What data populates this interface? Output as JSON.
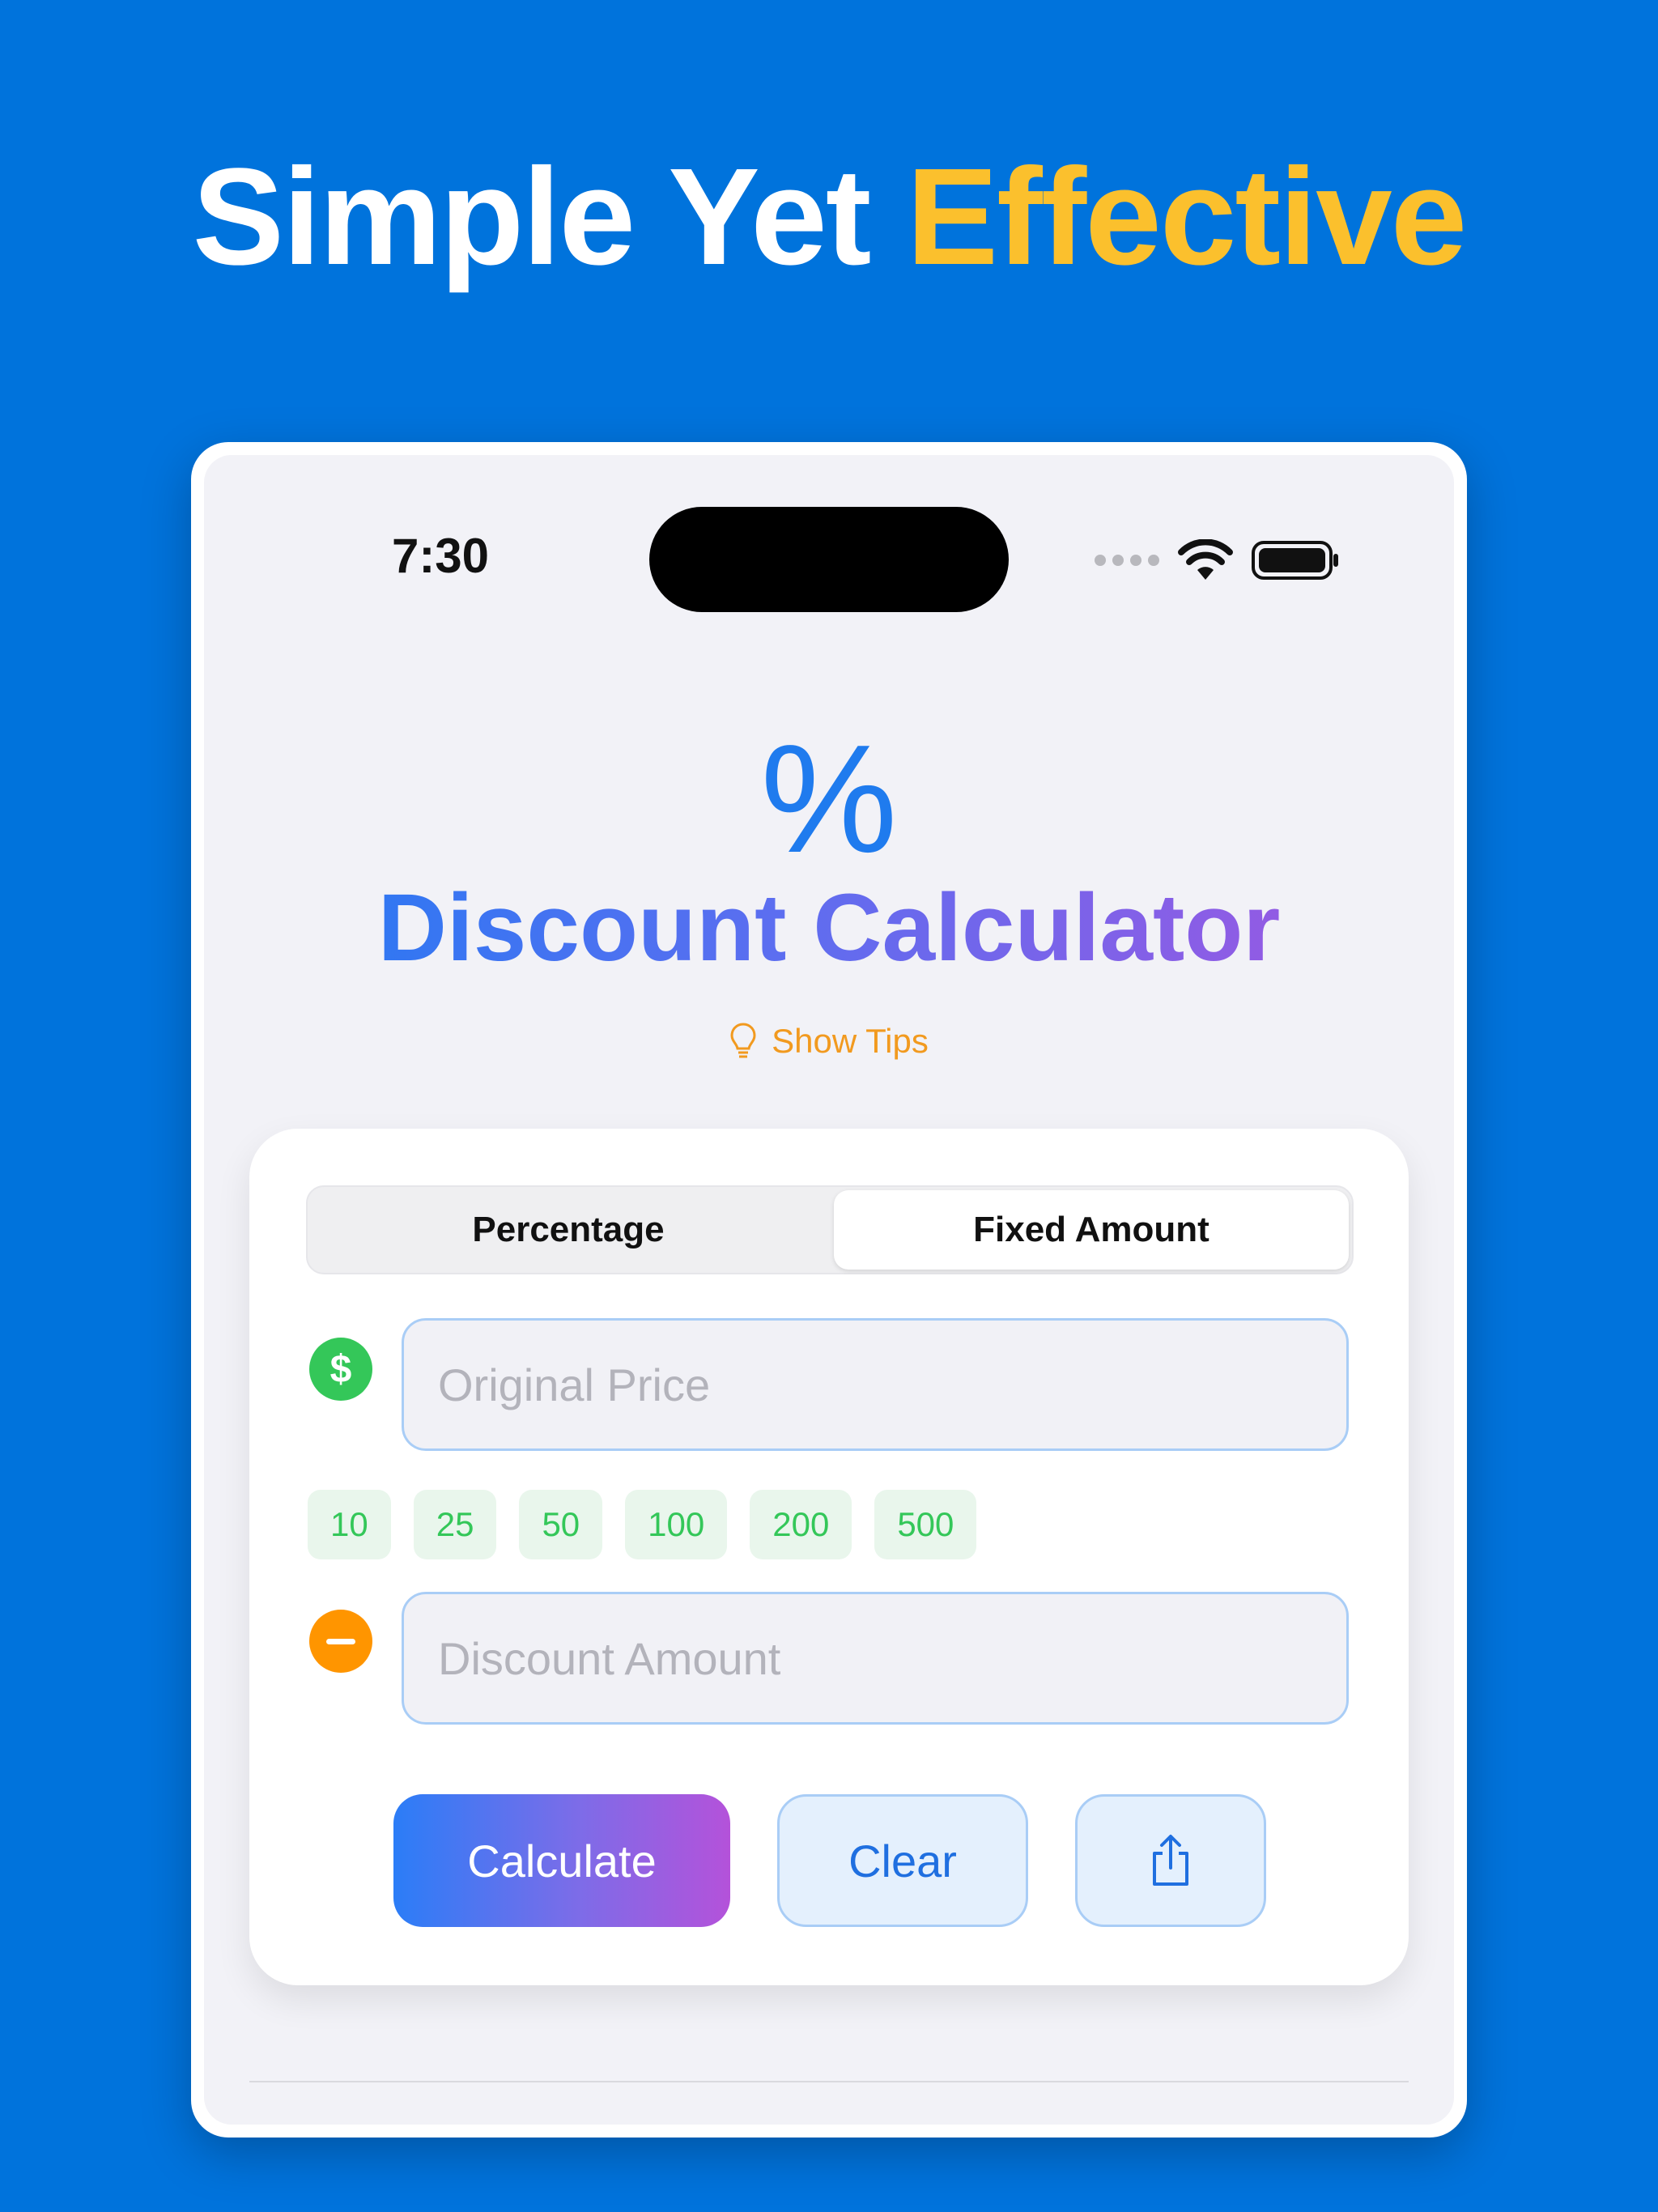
{
  "headline": {
    "part1": "Simple Yet",
    "part2": "Effective"
  },
  "status_bar": {
    "time": "7:30"
  },
  "app": {
    "icon_glyph": "%",
    "title": "Discount Calculator",
    "tips_label": "Show Tips"
  },
  "mode": {
    "options": [
      "Percentage",
      "Fixed Amount"
    ],
    "selected": "Fixed Amount"
  },
  "original_price": {
    "value": "",
    "placeholder": "Original Price",
    "icon": "dollar-icon"
  },
  "quick_amounts": [
    "10",
    "25",
    "50",
    "100",
    "200",
    "500"
  ],
  "discount_amount": {
    "value": "",
    "placeholder": "Discount Amount",
    "icon": "minus-icon"
  },
  "actions": {
    "calculate": "Calculate",
    "clear": "Clear",
    "share_icon": "share-icon"
  },
  "colors": {
    "background": "#0073dc",
    "accent_yellow": "#fbc02d",
    "primary_blue": "#1f7bee",
    "green": "#34c759",
    "orange": "#ff9500",
    "purple": "#a455e0"
  }
}
